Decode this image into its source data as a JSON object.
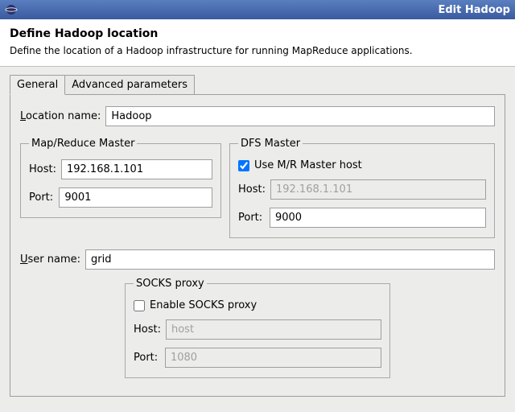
{
  "window": {
    "title": "Edit Hadoop"
  },
  "header": {
    "title": "Define Hadoop location",
    "subtitle": "Define the location of a Hadoop infrastructure for running MapReduce applications."
  },
  "tabs": {
    "general": "General",
    "advanced": "Advanced parameters"
  },
  "form": {
    "location_prefix": "L",
    "location_rest": "ocation name:",
    "location_value": "Hadoop",
    "user_prefix": "U",
    "user_rest": "ser name:",
    "user_value": "grid"
  },
  "mr": {
    "legend": "Map/Reduce Master",
    "host_label": "Host:",
    "host_value": "192.168.1.101",
    "port_label": "Port:",
    "port_value": "9001"
  },
  "dfs": {
    "legend": "DFS Master",
    "use_mr_label": "Use M/R Master host",
    "host_label": "Host:",
    "host_value": "192.168.1.101",
    "port_label": "Port:",
    "port_value": "9000"
  },
  "socks": {
    "legend": "SOCKS proxy",
    "enable_label": "Enable SOCKS proxy",
    "host_label": "Host:",
    "host_placeholder": "host",
    "port_label": "Port:",
    "port_placeholder": "1080"
  }
}
